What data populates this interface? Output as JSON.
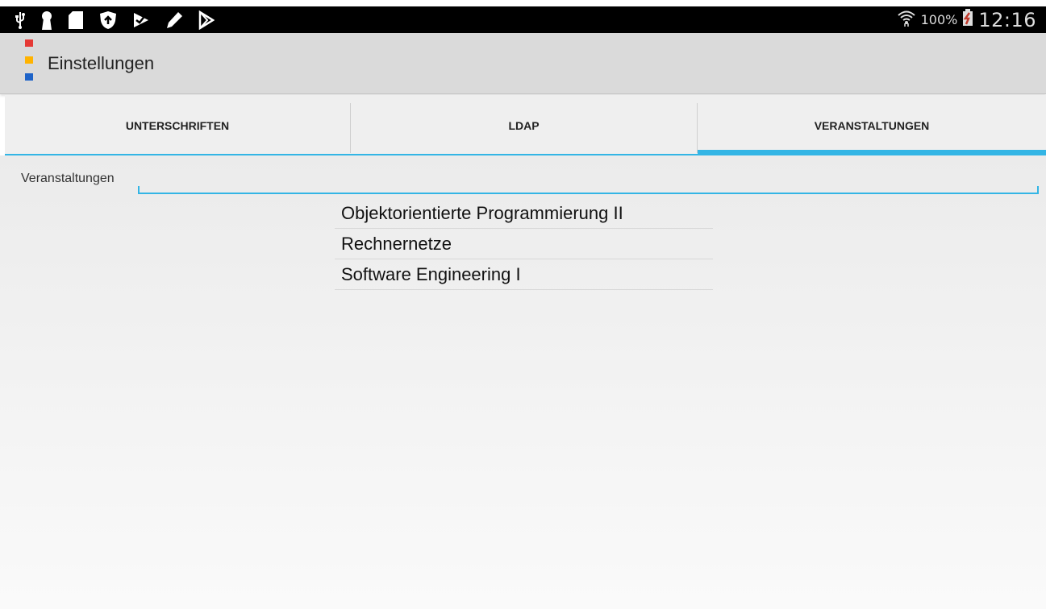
{
  "status_bar": {
    "left_icons": [
      "usb-icon",
      "keyhole-icon",
      "sim-card-icon",
      "shield-update-icon",
      "tasks-check-icon",
      "pen-icon",
      "play-store-icon"
    ],
    "battery_percent": "100%",
    "time": "12:16"
  },
  "action_bar": {
    "title": "Einstellungen",
    "logo_colors": [
      "#e53935",
      "#ffb300",
      "#1e63c8"
    ]
  },
  "tabs": [
    {
      "label": "UNTERSCHRIFTEN",
      "selected": false
    },
    {
      "label": "LDAP",
      "selected": false
    },
    {
      "label": "VERANSTALTUNGEN",
      "selected": true
    }
  ],
  "form": {
    "label": "Veranstaltungen",
    "value": "",
    "placeholder": ""
  },
  "list": {
    "items": [
      "Objektorientierte Programmierung II",
      "Rechnernetze",
      "Software Engineering I"
    ]
  },
  "colors": {
    "accent": "#33b5e5",
    "status_bar": "#000000",
    "action_bar": "#dadada"
  }
}
